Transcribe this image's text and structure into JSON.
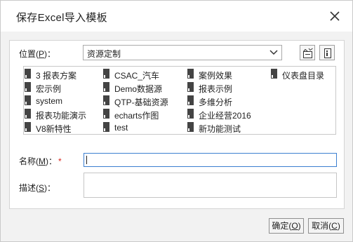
{
  "dialog": {
    "title": "保存Excel导入模板",
    "close_label": "关闭"
  },
  "location": {
    "label": "位置(",
    "mnemonic": "P",
    "label_suffix": ")：",
    "selected": "资源定制",
    "buttons": [
      "new-folder-icon",
      "properties-icon"
    ]
  },
  "tree": {
    "items": [
      {
        "label": "3 报表方案"
      },
      {
        "label": "CSAC_汽车"
      },
      {
        "label": "案例效果"
      },
      {
        "label": "仪表盘目录"
      },
      {
        "label": "宏示例"
      },
      {
        "label": "Demo数据源"
      },
      {
        "label": "报表示例"
      },
      {
        "label": "system"
      },
      {
        "label": "QTP-基础资源"
      },
      {
        "label": "多维分析"
      },
      {
        "label": "报表功能演示"
      },
      {
        "label": "echarts作图"
      },
      {
        "label": "企业经营2016"
      },
      {
        "label": "V8新特性"
      },
      {
        "label": "test"
      },
      {
        "label": "新功能测试"
      }
    ]
  },
  "name_field": {
    "label": "名称(",
    "mnemonic": "M",
    "label_suffix": ")：",
    "required_mark": "*",
    "value": ""
  },
  "desc_field": {
    "label": "描述(",
    "mnemonic": "S",
    "label_suffix": ")：",
    "value": ""
  },
  "buttons": {
    "ok": {
      "label": "确定(",
      "mnemonic": "O",
      "suffix": ")"
    },
    "cancel": {
      "label": "取消(",
      "mnemonic": "C",
      "suffix": ")"
    }
  },
  "colors": {
    "accent_border": "#3c7fd1",
    "required": "#d9261c",
    "folder_icon": "#444444"
  }
}
